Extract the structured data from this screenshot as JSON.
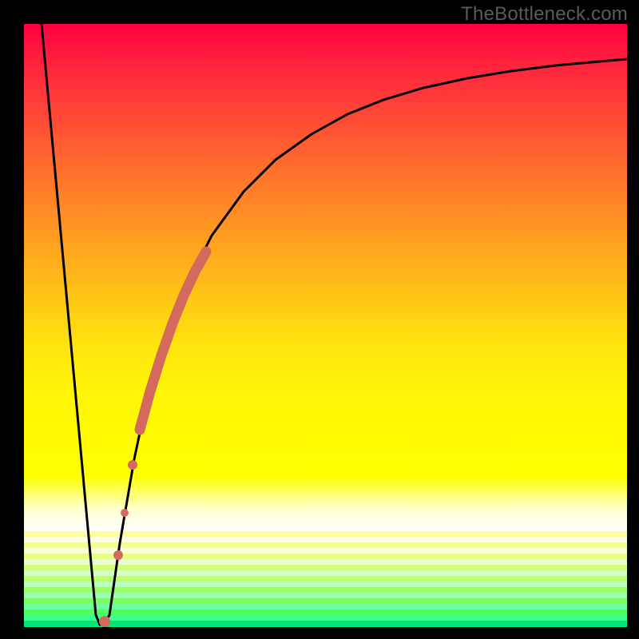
{
  "watermark": "TheBottleneck.com",
  "chart_data": {
    "type": "line",
    "title": "",
    "xlabel": "",
    "ylabel": "",
    "xlim": [
      0,
      100
    ],
    "ylim": [
      0,
      100
    ],
    "grid": false,
    "legend": false,
    "background_gradient": {
      "orientation": "vertical",
      "stops": [
        {
          "pos": 0.0,
          "color": "#ff0042"
        },
        {
          "pos": 0.35,
          "color": "#ff7a2a"
        },
        {
          "pos": 0.7,
          "color": "#ffff00"
        },
        {
          "pos": 0.82,
          "color": "#ffffcc"
        },
        {
          "pos": 0.99,
          "color": "#00e060"
        }
      ]
    },
    "series": [
      {
        "name": "bottleneck-curve",
        "color": "#000000",
        "x": [
          3,
          6,
          9,
          11,
          12,
          13,
          14,
          16,
          18,
          20,
          22,
          25,
          30,
          35,
          40,
          45,
          50,
          55,
          60,
          65,
          70,
          75,
          80,
          85,
          90,
          95,
          100
        ],
        "y": [
          100,
          68,
          36,
          12,
          3,
          0,
          3,
          14,
          27,
          38,
          47,
          57,
          68,
          75,
          80,
          83.5,
          86,
          88,
          89.5,
          90.7,
          91.6,
          92.3,
          92.9,
          93.4,
          93.8,
          94.1,
          94.4
        ]
      }
    ],
    "highlight_segment": {
      "note": "thick salmon overlay on rising part of curve",
      "color": "#d46a5e",
      "x": [
        13.5,
        15,
        17,
        19,
        21,
        23,
        25,
        27,
        29,
        30.5
      ],
      "y": [
        1,
        9,
        21,
        32,
        42,
        50,
        56,
        61,
        64.5,
        67
      ]
    },
    "highlight_dots": {
      "color": "#d46a5e",
      "points": [
        {
          "x": 13.0,
          "y": 0.5
        },
        {
          "x": 15.2,
          "y": 10
        },
        {
          "x": 16.2,
          "y": 17
        },
        {
          "x": 17.8,
          "y": 26
        }
      ]
    }
  }
}
